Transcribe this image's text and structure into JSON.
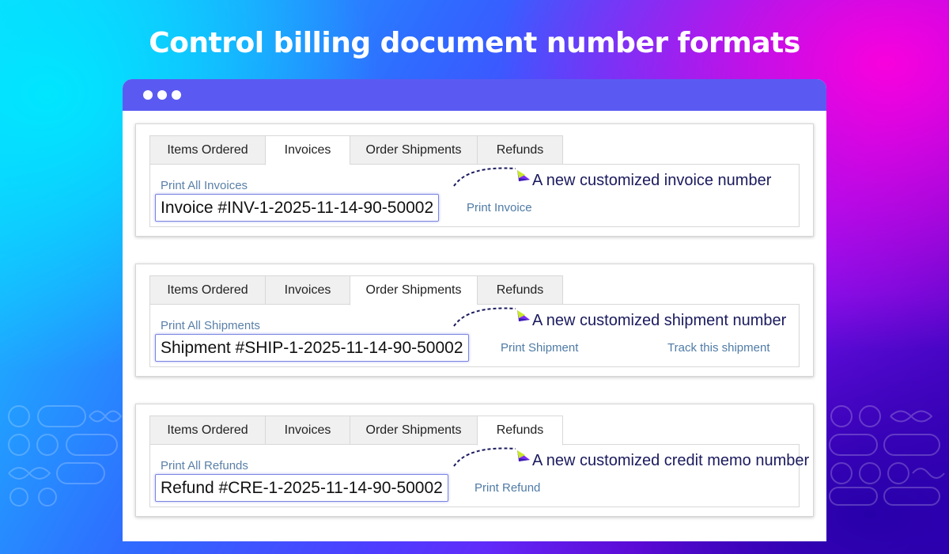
{
  "headline": "Control billing document number formats",
  "tab_labels": {
    "items_ordered": "Items Ordered",
    "invoices": "Invoices",
    "order_shipments": "Order Shipments",
    "refunds": "Refunds"
  },
  "invoice_card": {
    "active_tab": "Invoices",
    "print_all": "Print All Invoices",
    "doc_number": "Invoice #INV-1-2025-11-14-90-50002",
    "print_link": "Print Invoice",
    "callout": "A new customized invoice number"
  },
  "shipment_card": {
    "active_tab": "Order Shipments",
    "print_all": "Print All Shipments",
    "doc_number": "Shipment #SHIP-1-2025-11-14-90-50002",
    "print_link": "Print Shipment",
    "track_link": "Track this shipment",
    "callout": "A new customized shipment number"
  },
  "refund_card": {
    "active_tab": "Refunds",
    "print_all": "Print All Refunds",
    "doc_number": "Refund #CRE-1-2025-11-14-90-50002",
    "print_link": "Print Refund",
    "callout": "A new customized credit memo number"
  },
  "colors": {
    "titlebar": "#5a5af2",
    "link": "#4f7ba6",
    "callout_text": "#1a1a5e",
    "highlight_border": "#7a85e0"
  },
  "icons": [
    "window-dot-icon",
    "callout-arrow-icon",
    "decorative-pattern-icon"
  ]
}
